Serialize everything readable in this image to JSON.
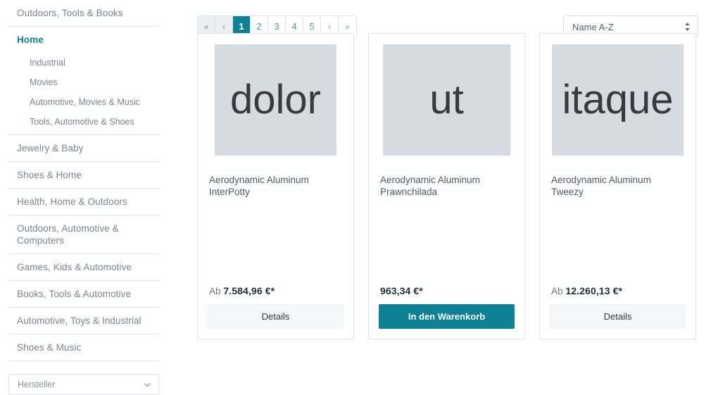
{
  "sidebar": {
    "nav": [
      {
        "label": "Outdoors, Tools & Books",
        "active": false
      },
      {
        "label": "Home",
        "active": true
      },
      {
        "label": "Jewelry & Baby",
        "active": false
      },
      {
        "label": "Shoes & Home",
        "active": false
      },
      {
        "label": "Health, Home & Outdoors",
        "active": false
      },
      {
        "label": "Outdoors, Automotive & Computers",
        "active": false
      },
      {
        "label": "Games, Kids & Automotive",
        "active": false
      },
      {
        "label": "Books, Tools & Automotive",
        "active": false
      },
      {
        "label": "Automotive, Toys & Industrial",
        "active": false
      },
      {
        "label": "Shoes & Music",
        "active": false
      }
    ],
    "sub_nav": [
      {
        "label": "Industrial"
      },
      {
        "label": "Movies"
      },
      {
        "label": "Automotive, Movies & Music"
      },
      {
        "label": "Tools, Automotive & Shoes"
      }
    ],
    "filter": {
      "label": "Hersteller",
      "icon": "chevron-down-icon"
    }
  },
  "toolbar": {
    "pagination": [
      {
        "label": "«",
        "name": "first-page",
        "kind": "arrow"
      },
      {
        "label": "‹",
        "name": "previous-page",
        "kind": "arrow"
      },
      {
        "label": "1",
        "name": "page-1",
        "kind": "current"
      },
      {
        "label": "2",
        "name": "page-2",
        "kind": "number"
      },
      {
        "label": "3",
        "name": "page-3",
        "kind": "number"
      },
      {
        "label": "4",
        "name": "page-4",
        "kind": "number"
      },
      {
        "label": "5",
        "name": "page-5",
        "kind": "number"
      },
      {
        "label": "›",
        "name": "next-page",
        "kind": "plain"
      },
      {
        "label": "»",
        "name": "last-page",
        "kind": "plain"
      }
    ],
    "sorting": {
      "selected": "Name A-Z",
      "icon": "sort-updown-icon"
    }
  },
  "products": [
    {
      "image_text": "dolor",
      "title": "Aerodynamic Aluminum InterPotty",
      "price_prefix": "Ab",
      "price": "7.584,96 €*",
      "button_label": "Details",
      "button_style": "secondary"
    },
    {
      "image_text": "ut",
      "title": "Aerodynamic Aluminum Prawnchilada",
      "price_prefix": "",
      "price": "963,34 €*",
      "button_label": "In den Warenkorb",
      "button_style": "primary"
    },
    {
      "image_text": "itaque",
      "title": "Aerodynamic Aluminum Tweezy",
      "price_prefix": "Ab",
      "price": "12.260,13 €*",
      "button_label": "Details",
      "button_style": "secondary"
    }
  ],
  "colors": {
    "accent": "#0d8296",
    "text": "#4a545b",
    "muted": "#798490",
    "border": "#dfe3e8",
    "placeholder_bg": "#d6dbe2"
  }
}
